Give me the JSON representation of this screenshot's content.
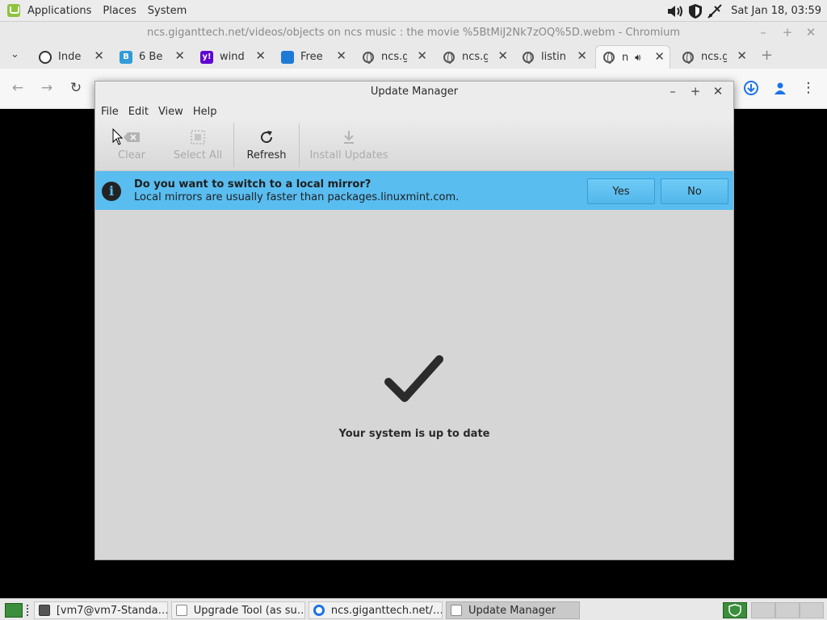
{
  "top_panel": {
    "menus": [
      "Applications",
      "Places",
      "System"
    ],
    "clock": "Sat Jan 18, 03:59"
  },
  "browser": {
    "window_title": "ncs.giganttech.net/videos/objects on ncs music :  the movie %5BtMiJ2Nk7zOQ%5D.webm - Chromium",
    "tabs": [
      {
        "title": "Inde",
        "favicon": "index-icon",
        "active": false
      },
      {
        "title": "6 Be",
        "favicon": "doc-icon",
        "active": false
      },
      {
        "title": "wind",
        "favicon": "yahoo-icon",
        "active": false
      },
      {
        "title": "Free",
        "favicon": "vm-icon",
        "active": false
      },
      {
        "title": "ncs.g",
        "favicon": "globe-icon",
        "active": false
      },
      {
        "title": "ncs.g",
        "favicon": "globe-icon",
        "active": false
      },
      {
        "title": "listin",
        "favicon": "globe-icon",
        "active": false
      },
      {
        "title": "n",
        "favicon": "globe-icon",
        "active": true,
        "audio": true
      },
      {
        "title": "ncs.g",
        "favicon": "globe-icon",
        "active": false
      }
    ]
  },
  "update_manager": {
    "title": "Update Manager",
    "menus": [
      "File",
      "Edit",
      "View",
      "Help"
    ],
    "toolbar": {
      "clear": "Clear",
      "select_all": "Select All",
      "refresh": "Refresh",
      "install_updates": "Install Updates"
    },
    "infobar": {
      "question": "Do you want to switch to a local mirror?",
      "detail": "Local mirrors are usually faster than packages.linuxmint.com.",
      "yes": "Yes",
      "no": "No"
    },
    "status": "Your system is up to date"
  },
  "taskbar": [
    {
      "label": "[vm7@vm7-Standa…",
      "icon": "terminal-icon",
      "active": false
    },
    {
      "label": "Upgrade Tool (as su…",
      "icon": "shield-icon",
      "active": false
    },
    {
      "label": "ncs.giganttech.net/…",
      "icon": "chromium-icon",
      "active": false
    },
    {
      "label": "Update Manager",
      "icon": "shield-icon",
      "active": true
    }
  ],
  "colors": {
    "infobar": "#59bdf0",
    "panel": "#ececec",
    "update_tray": "#3b8e3b"
  }
}
